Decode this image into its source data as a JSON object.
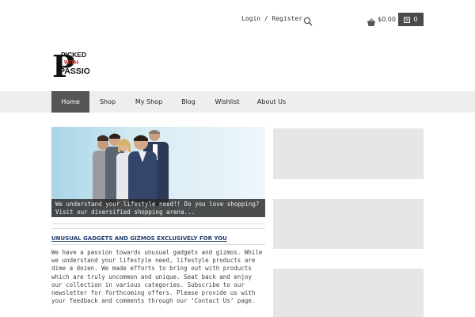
{
  "header": {
    "login_register": "Login / Register",
    "cart_total": "$0.00",
    "cart_count": "0",
    "logo_text": {
      "line1": "PICKED",
      "line2": "WITH",
      "line3": "PASSION"
    },
    "icons": [
      "search-icon",
      "shopping-basket-icon",
      "cart-bag-icon"
    ]
  },
  "nav": {
    "items": [
      {
        "label": "Home",
        "active": true
      },
      {
        "label": "Shop",
        "active": false
      },
      {
        "label": "My Shop",
        "active": false
      },
      {
        "label": "Blog",
        "active": false
      },
      {
        "label": "Wishlist",
        "active": false
      },
      {
        "label": "About Us",
        "active": false
      }
    ]
  },
  "hero": {
    "caption": "We understand your lifestyle need!! Do you love shopping? Visit our diversified shopping arena..."
  },
  "article": {
    "headline": "UNUSUAL GADGETS AND GIZMOS EXCLUSIVELY FOR YOU",
    "body": "We have a passion towards unusual gadgets and gizmos. While we understand your lifestyle need, lifestyle products are dime a dozen. We made efforts to bring out with products which are truly uncommon and unique. Seat back and enjoy our collection in various categories. Subscribe to our newsletter for forthcoming offers. Please provide us with your feedback and comments through our ‘Contact Us’ page."
  },
  "colors": {
    "nav_bg": "#eeeeee",
    "nav_active": "#555555",
    "cart_badge": "#4a4a4a",
    "headline": "#1f3a6d",
    "placeholder": "#e6e6e6"
  }
}
